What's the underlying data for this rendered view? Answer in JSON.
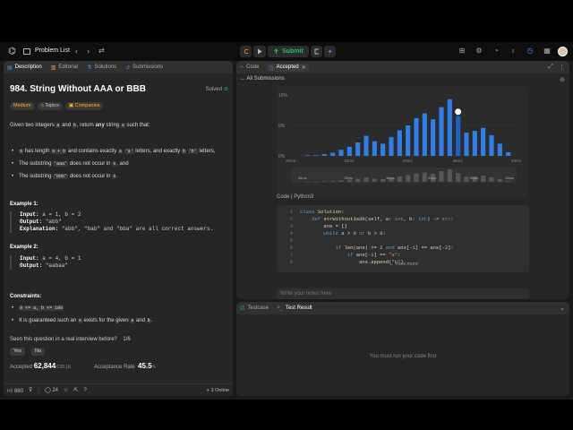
{
  "nav": {
    "logo": "⌬",
    "problem_list": "Problem List",
    "prev": "‹",
    "next": "›",
    "shuffle": "⇄",
    "submit": "Submit",
    "star_icon": "☆"
  },
  "left": {
    "tabs": [
      {
        "label": "Description"
      },
      {
        "label": "Editorial"
      },
      {
        "label": "Solutions"
      },
      {
        "label": "Submissions"
      }
    ],
    "title": "984. String Without AAA or BBB",
    "solved": "Solved",
    "tags": [
      "Medium",
      "Topics",
      "Companies"
    ],
    "desc": {
      "p1a": "Given two integers",
      "a": "a",
      "and": "and",
      "b": "b",
      "p1b": ", return",
      "any": "any",
      "p1c": "string",
      "s": "s",
      "p1d": "such that:"
    },
    "bullets": {
      "b1a": "has length",
      "b1code": "a + b",
      "b1b": "and contains exactly",
      "b1a_code": "a",
      "b1c": "'a'",
      "b1d": "letters, and exactly",
      "b1b_code": "b",
      "b1e": "'b'",
      "b1f": "letters,",
      "b2a": "The substring",
      "b2code": "'aaa'",
      "b2b": "does not occur in",
      "b2c": ", and",
      "b3a": "The substring",
      "b3code": "'bbb'",
      "b3b": "does not occur in",
      "b3c": "."
    },
    "ex1": {
      "title": "Example 1:",
      "input_label": "Input:",
      "input": "a = 1, b = 2",
      "output_label": "Output:",
      "output": "\"abb\"",
      "expl_label": "Explanation:",
      "expl": "\"abb\", \"bab\" and \"bba\" are all correct answers."
    },
    "ex2": {
      "title": "Example 2:",
      "input_label": "Input:",
      "input": "a = 4, b = 1",
      "output_label": "Output:",
      "output": "\"aabaa\""
    },
    "constraints": {
      "title": "Constraints:",
      "c1": "0 <= a, b <= 100",
      "c2a": "It is guaranteed such an",
      "c2b": "exists for the given",
      "c2c": "and",
      "c2d": "."
    },
    "seen": "Seen this question in a real interview before?",
    "seen_page": "1/6",
    "yes": "Yes",
    "no": "No",
    "accepted_label": "Accepted",
    "accepted_val": "62,844",
    "accepted_total": "/138.1K",
    "rate_label": "Acceptance Rate",
    "rate_val": "45.5",
    "rate_unit": "%",
    "likes": "880",
    "comments": "24",
    "online": "3 Online"
  },
  "right": {
    "tabs": [
      {
        "label": "Code"
      },
      {
        "label": "Accepted"
      }
    ],
    "all_submissions": "All Submissions",
    "code_lang_label": "Code",
    "code_lang": "Python3",
    "code_lines": [
      "class Solution:",
      "    def strWithout3a3b(self, a: int, b: int) -> str:",
      "        ans = []",
      "        while a > 0 or b > 0:",
      "",
      "            if len(ans) >= 2 and ans[-1] == ans[-2]:",
      "                if ans[-1] == \"a\":",
      "                    ans.append(\"b\")"
    ],
    "view_more": "View more",
    "notes_placeholder": "Write your notes here",
    "bottom_tabs": [
      {
        "label": "Testcase"
      },
      {
        "label": "Test Result"
      }
    ],
    "run_msg": "You must run your code first"
  },
  "chart_data": {
    "type": "bar",
    "ylabels": [
      "10%",
      "5%",
      "0%"
    ],
    "yticks": [
      10,
      5,
      0
    ],
    "ylim": [
      0,
      10
    ],
    "xlabels": [
      "26ms",
      "33ms",
      "40ms",
      "46ms",
      "53ms"
    ],
    "xlabel_positions": [
      26,
      33,
      40,
      46,
      53
    ],
    "x": [
      28,
      29,
      30,
      31,
      32,
      33,
      34,
      35,
      36,
      37,
      38,
      39,
      40,
      41,
      42,
      43,
      44,
      45,
      46,
      47,
      48,
      49,
      50,
      51,
      52
    ],
    "values": [
      0.1,
      0.1,
      0.3,
      0.5,
      1.0,
      1.5,
      2.2,
      3.3,
      2.4,
      2.0,
      3.1,
      4.2,
      5.0,
      6.2,
      7.0,
      6.0,
      8.0,
      9.3,
      6.5,
      3.8,
      4.1,
      4.6,
      3.4,
      2.0,
      0.6
    ],
    "highlight_index": 18,
    "color": "#2f7fe6",
    "highlight_color": "#1e5fc2",
    "mini_xlabels": [
      "26ms",
      "33ms",
      "38ms",
      "43ms",
      "48ms",
      "53ms"
    ]
  }
}
